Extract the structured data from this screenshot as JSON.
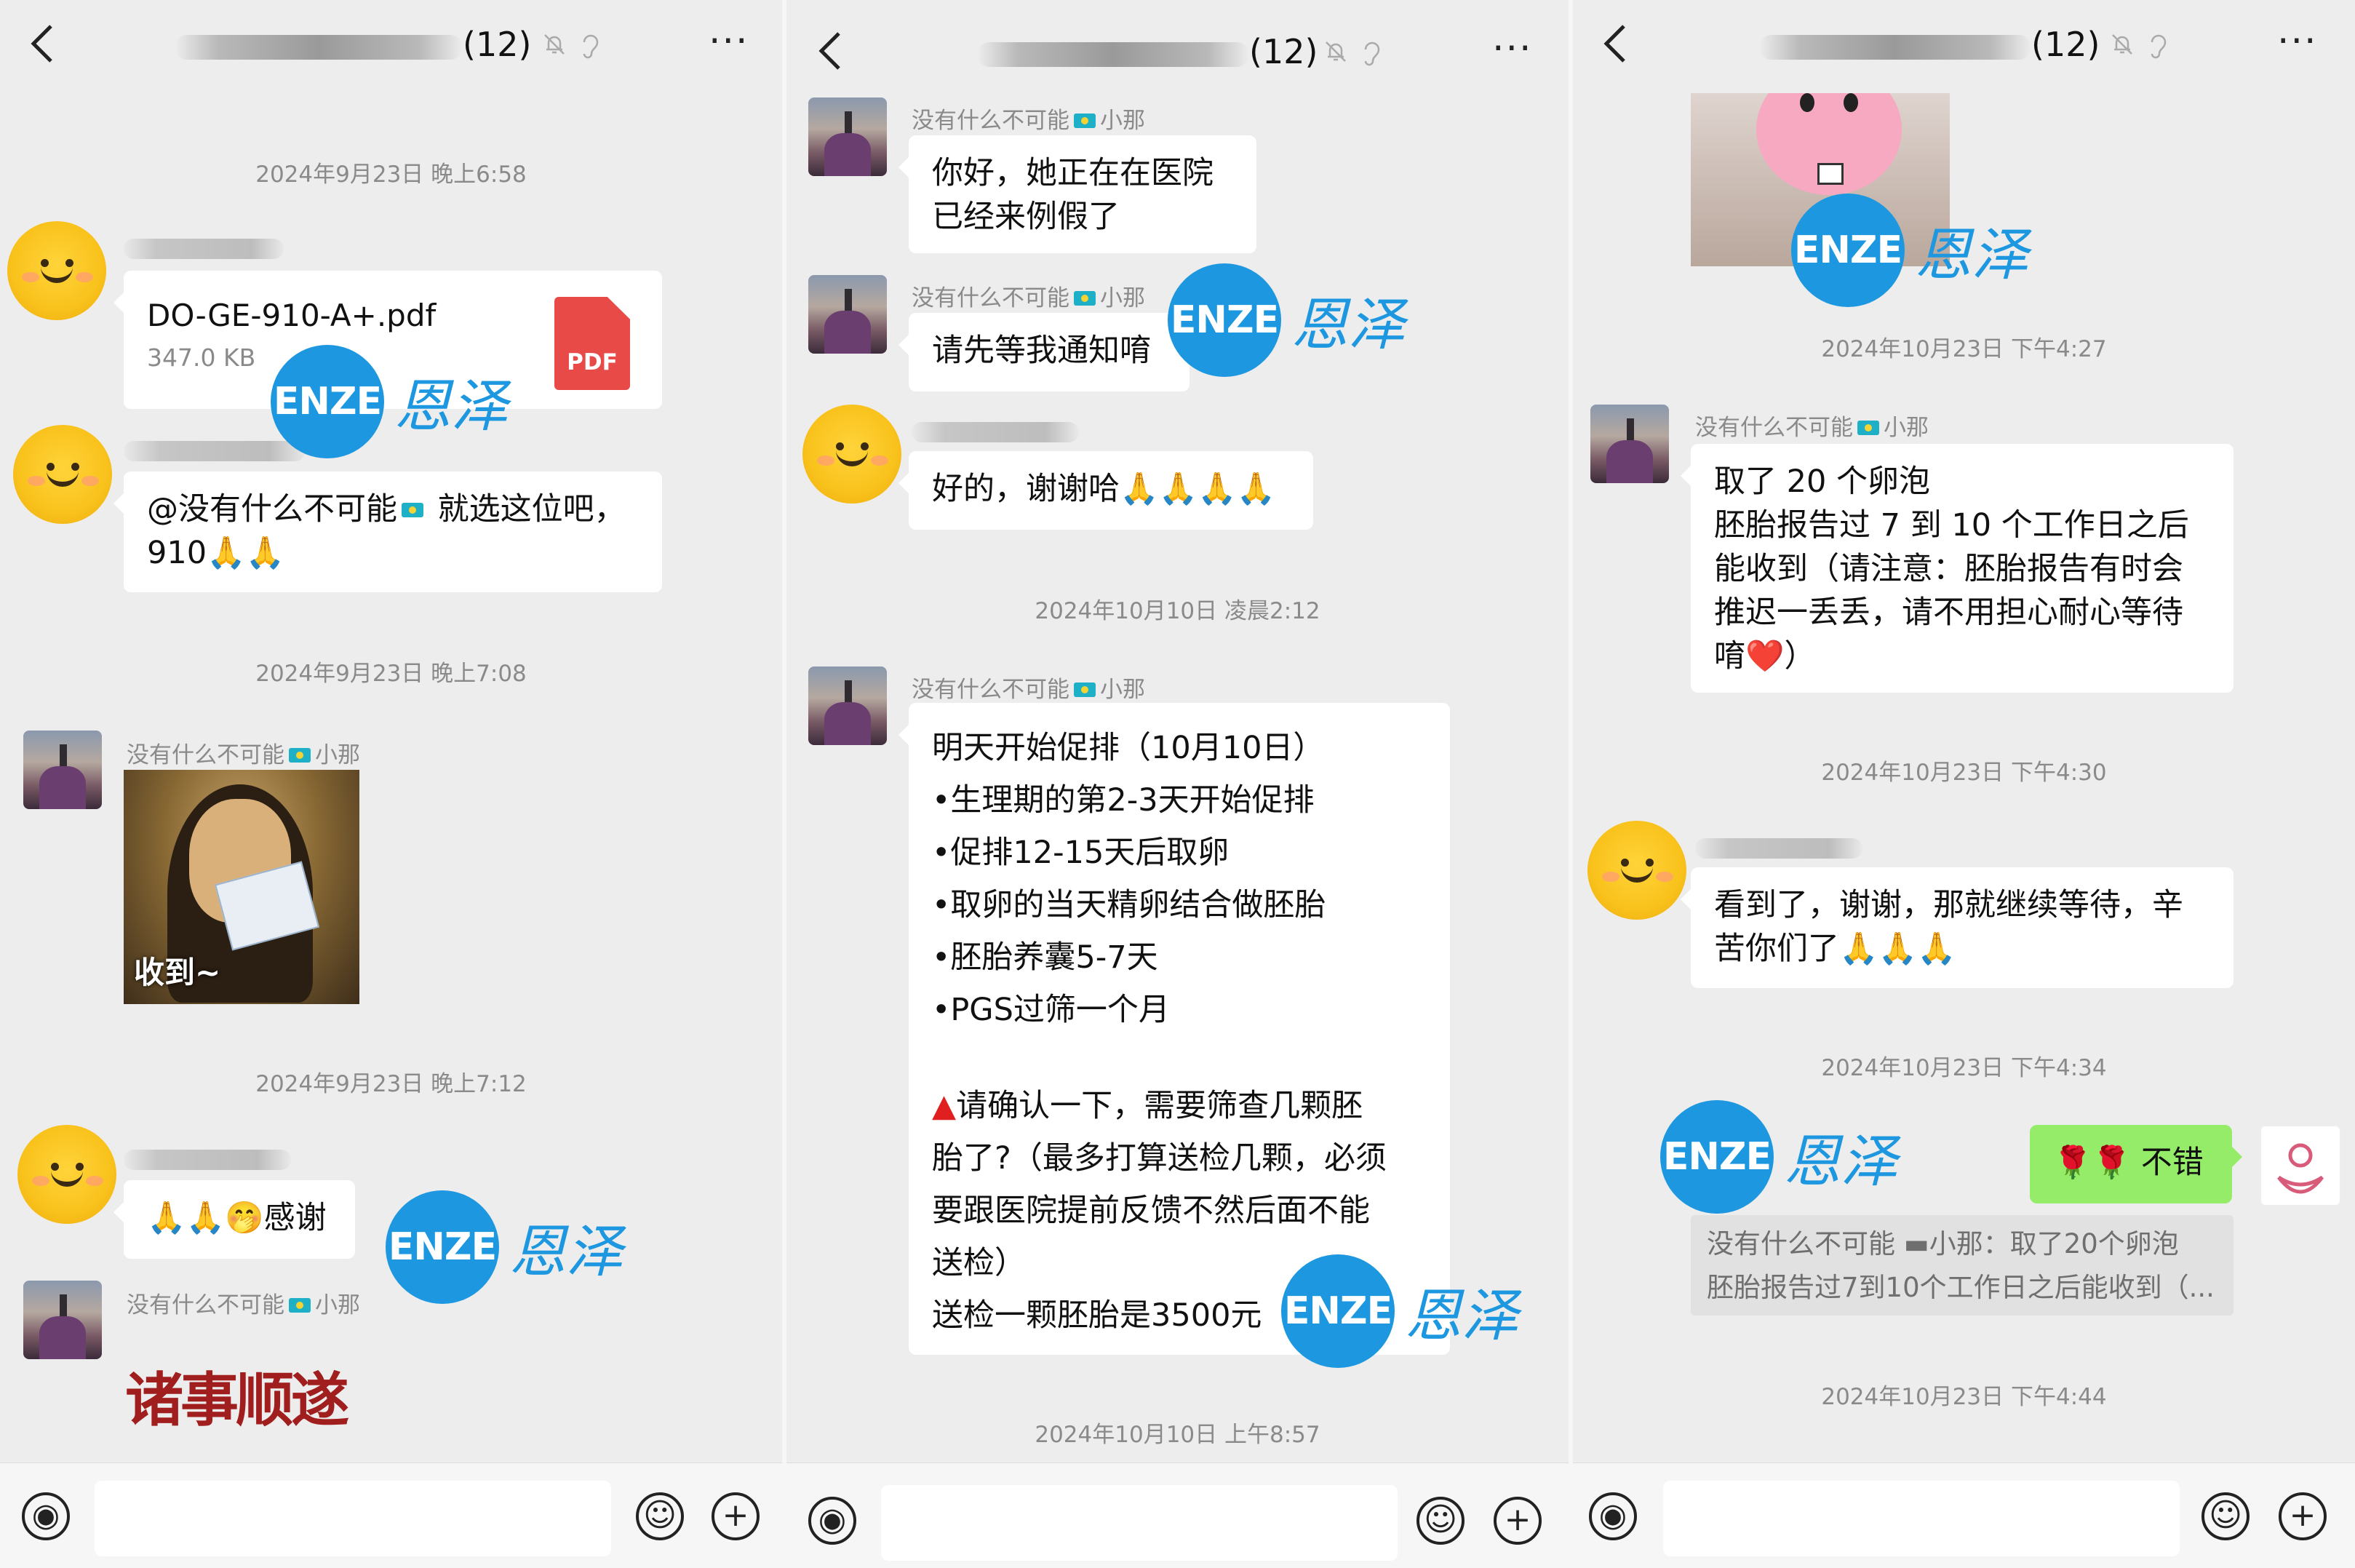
{
  "panels": [
    {
      "title_suffix": "(12)",
      "more": "···",
      "timestamps": [
        "2024年9月23日 晚上6:58",
        "2024年9月23日 晚上7:08",
        "2024年9月23日 晚上7:12"
      ],
      "file": {
        "name": "DO-GE-910-A+.pdf",
        "size": "347.0 KB",
        "badge": "PDF"
      },
      "msg_mention": [
        "@没有什么不可能",
        "就选这位吧，",
        "910🙏🙏"
      ],
      "sender_name": "没有什么不可能",
      "sender_suffix": "小那",
      "sticker_caption": "收到~",
      "msg_thanks": "🙏🙏🤭感谢",
      "fortune_text": "诸事顺遂"
    },
    {
      "title_suffix": "(12)",
      "more": "···",
      "sender_name": "没有什么不可能",
      "sender_suffix": "小那",
      "msg_hospital": [
        "你好，她正在在医院",
        "已经来例假了"
      ],
      "msg_wait": "请先等我通知唷",
      "msg_ok": "好的，谢谢哈🙏🙏🙏🙏",
      "timestamps": [
        "2024年10月10日 凌晨2:12",
        "2024年10月10日 上午8:57"
      ],
      "schedule": [
        "明天开始促排（10月10日）",
        "•生理期的第2-3天开始促排",
        "•促排12-15天后取卵",
        "•取卵的当天精卵结合做胚胎",
        "•胚胎养囊5-7天",
        "•PGS过筛一个月"
      ],
      "confirm": [
        "请确认一下，需要筛查几颗胚",
        "胎了?（最多打算送检几颗，必须",
        "要跟医院提前反馈不然后面不能",
        "送检）",
        "送检一颗胚胎是3500元"
      ],
      "warn_icon": "▲"
    },
    {
      "title_suffix": "(12)",
      "more": "···",
      "timestamps": [
        "2024年10月23日 下午4:27",
        "2024年10月23日 下午4:30",
        "2024年10月23日 下午4:34",
        "2024年10月23日 下午4:44"
      ],
      "sender_name": "没有什么不可能",
      "sender_suffix": "小那",
      "msg_report": [
        "取了 20 个卵泡",
        "胚胎报告过 7 到 10 个工作日之后",
        "能收到（请注意：胚胎报告有时会",
        "推迟一丢丢，请不用担心耐心等待",
        "唷❤️）"
      ],
      "msg_seen": [
        "看到了，谢谢，那就继续等待，辛",
        "苦你们了🙏🙏🙏"
      ],
      "msg_reply": "🌹🌹 不错",
      "quote": [
        "没有什么不可能 ▬小那：取了20个卵泡",
        "胚胎报告过7到10个工作日之后能收到（..."
      ]
    }
  ],
  "watermark": {
    "logo": "ENZE",
    "text": "恩泽"
  },
  "icons": {
    "back": "chevron-left-icon",
    "mute": "bell-off-icon",
    "ear": "ear-icon",
    "voice": "voice-icon",
    "emoji": "emoji-icon",
    "plus": "plus-icon"
  },
  "colors": {
    "bubble_green": "#95ec69",
    "watermark_blue": "#1c97e0",
    "bg": "#ededed"
  }
}
